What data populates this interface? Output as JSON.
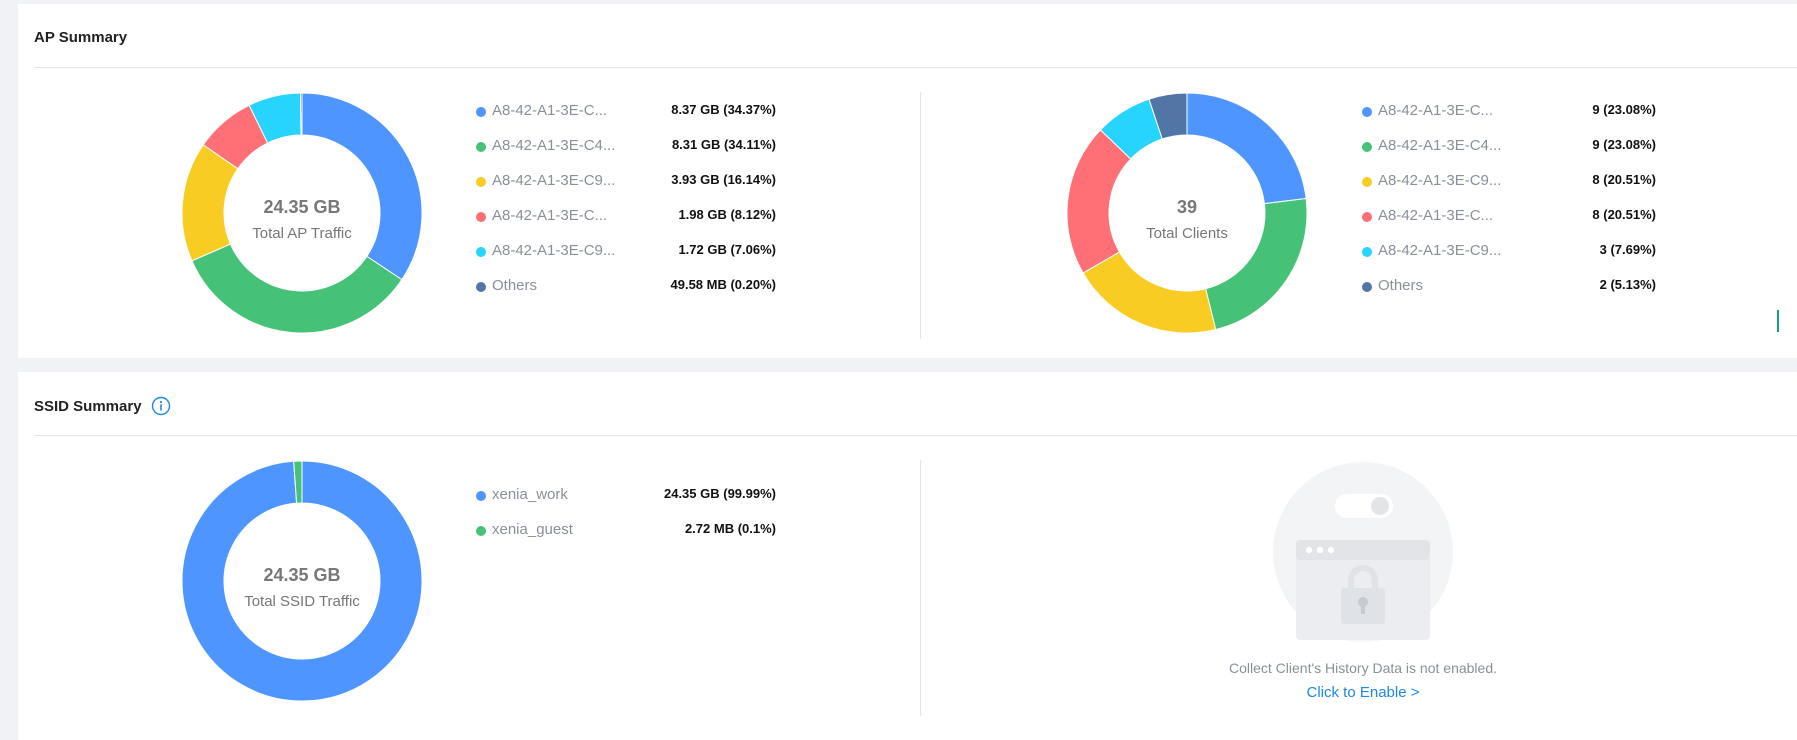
{
  "ap_summary": {
    "title": "AP Summary",
    "traffic": {
      "center_value": "24.35 GB",
      "center_label": "Total AP Traffic",
      "items": [
        {
          "name": "A8-42-A1-3E-C...",
          "value_text": "8.37 GB (34.37%)",
          "percent": 34.37,
          "color": "#4e95ff"
        },
        {
          "name": "A8-42-A1-3E-C4...",
          "value_text": "8.31 GB (34.11%)",
          "percent": 34.11,
          "color": "#45c277"
        },
        {
          "name": "A8-42-A1-3E-C9...",
          "value_text": "3.93 GB (16.14%)",
          "percent": 16.14,
          "color": "#f8cc22"
        },
        {
          "name": "A8-42-A1-3E-C...",
          "value_text": "1.98 GB (8.12%)",
          "percent": 8.12,
          "color": "#fe6f76"
        },
        {
          "name": "A8-42-A1-3E-C9...",
          "value_text": "1.72 GB (7.06%)",
          "percent": 7.06,
          "color": "#27d4fe"
        },
        {
          "name": "Others",
          "value_text": "49.58 MB (0.20%)",
          "percent": 0.2,
          "color": "#5176a5"
        }
      ]
    },
    "clients": {
      "center_value": "39",
      "center_label": "Total Clients",
      "items": [
        {
          "name": "A8-42-A1-3E-C...",
          "value_text": "9 (23.08%)",
          "percent": 23.08,
          "color": "#4e95ff"
        },
        {
          "name": "A8-42-A1-3E-C4...",
          "value_text": "9 (23.08%)",
          "percent": 23.08,
          "color": "#45c277"
        },
        {
          "name": "A8-42-A1-3E-C9...",
          "value_text": "8 (20.51%)",
          "percent": 20.51,
          "color": "#f8cc22"
        },
        {
          "name": "A8-42-A1-3E-C...",
          "value_text": "8 (20.51%)",
          "percent": 20.51,
          "color": "#fe6f76"
        },
        {
          "name": "A8-42-A1-3E-C9...",
          "value_text": "3 (7.69%)",
          "percent": 7.69,
          "color": "#27d4fe"
        },
        {
          "name": "Others",
          "value_text": "2 (5.13%)",
          "percent": 5.13,
          "color": "#5176a5"
        }
      ]
    }
  },
  "ssid_summary": {
    "title": "SSID Summary",
    "info_icon": "info-icon",
    "traffic": {
      "center_value": "24.35 GB",
      "center_label": "Total SSID Traffic",
      "items": [
        {
          "name": "xenia_work",
          "value_text": "24.35 GB (99.99%)",
          "percent": 98.9,
          "color": "#4e95ff"
        },
        {
          "name": "xenia_guest",
          "value_text": "2.72 MB (0.1%)",
          "percent": 1.1,
          "color": "#45c277"
        }
      ]
    },
    "client_history": {
      "message": "Collect Client's History Data is not enabled.",
      "link_label": "Click to Enable >"
    }
  }
}
